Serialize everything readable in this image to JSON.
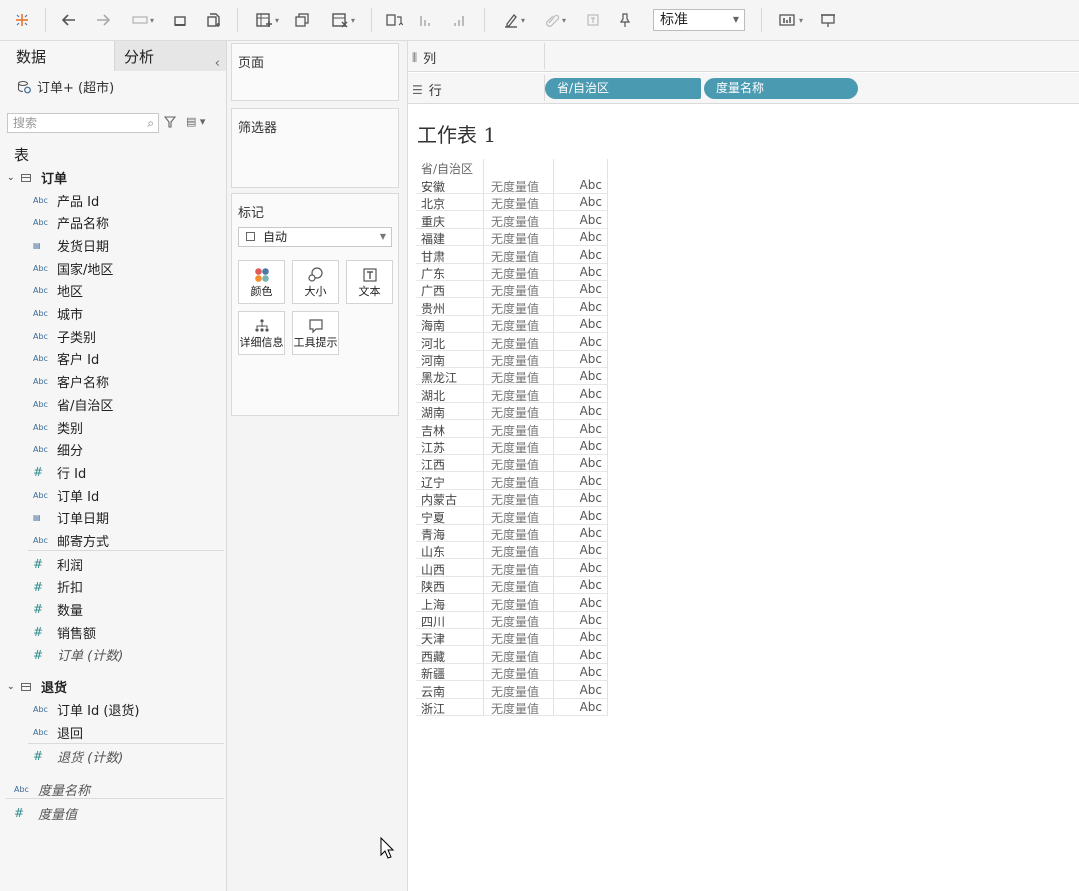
{
  "toolbar": {
    "display_mode": "标准"
  },
  "left_pane": {
    "tabs": {
      "data": "数据",
      "analysis": "分析",
      "collapse": "‹"
    },
    "datasource": "订单+ (超市)",
    "search_placeholder": "搜索",
    "tables_label": "表",
    "groups": [
      {
        "name": "订单",
        "fields": [
          {
            "type": "Abc",
            "name": "产品 Id"
          },
          {
            "type": "Abc",
            "name": "产品名称"
          },
          {
            "type": "date",
            "name": "发货日期"
          },
          {
            "type": "Abc",
            "name": "国家/地区"
          },
          {
            "type": "Abc",
            "name": "地区"
          },
          {
            "type": "Abc",
            "name": "城市"
          },
          {
            "type": "Abc",
            "name": "子类别"
          },
          {
            "type": "Abc",
            "name": "客户 Id"
          },
          {
            "type": "Abc",
            "name": "客户名称"
          },
          {
            "type": "Abc",
            "name": "省/自治区"
          },
          {
            "type": "Abc",
            "name": "类别"
          },
          {
            "type": "Abc",
            "name": "细分"
          },
          {
            "type": "#",
            "name": "行 Id"
          },
          {
            "type": "Abc",
            "name": "订单 Id"
          },
          {
            "type": "date",
            "name": "订单日期"
          },
          {
            "type": "Abc",
            "name": "邮寄方式"
          },
          {
            "type": "#",
            "name": "利润"
          },
          {
            "type": "#",
            "name": "折扣"
          },
          {
            "type": "#",
            "name": "数量"
          },
          {
            "type": "#",
            "name": "销售额"
          },
          {
            "type": "#",
            "name": "订单 (计数)"
          }
        ]
      },
      {
        "name": "退货",
        "fields": [
          {
            "type": "Abc",
            "name": "订单 Id (退货)"
          },
          {
            "type": "Abc",
            "name": "退回"
          },
          {
            "type": "#",
            "name": "退货 (计数)"
          }
        ]
      }
    ],
    "extra_fields": [
      {
        "type": "Abc",
        "name": "度量名称"
      },
      {
        "type": "#",
        "name": "度量值"
      }
    ]
  },
  "shelves": {
    "pages": "页面",
    "filters": "筛选器",
    "marks": "标记",
    "mark_type": "自动",
    "mark_buttons": [
      "颜色",
      "大小",
      "文本",
      "详细信息",
      "工具提示"
    ],
    "columns_label": "列",
    "rows_label": "行",
    "row_pills": [
      "省/自治区",
      "度量名称"
    ]
  },
  "view": {
    "title": "工作表 1",
    "header": "省/自治区",
    "measure_text": "无度量值",
    "value_text": "Abc",
    "provinces": [
      "安徽",
      "北京",
      "重庆",
      "福建",
      "甘肃",
      "广东",
      "广西",
      "贵州",
      "海南",
      "河北",
      "河南",
      "黑龙江",
      "湖北",
      "湖南",
      "吉林",
      "江苏",
      "江西",
      "辽宁",
      "内蒙古",
      "宁夏",
      "青海",
      "山东",
      "山西",
      "陕西",
      "上海",
      "四川",
      "天津",
      "西藏",
      "新疆",
      "云南",
      "浙江"
    ]
  },
  "colors": {
    "pill": "#4a9ab2",
    "accent_blue": "#3a6a96",
    "measure_teal": "#2e8b8b"
  }
}
